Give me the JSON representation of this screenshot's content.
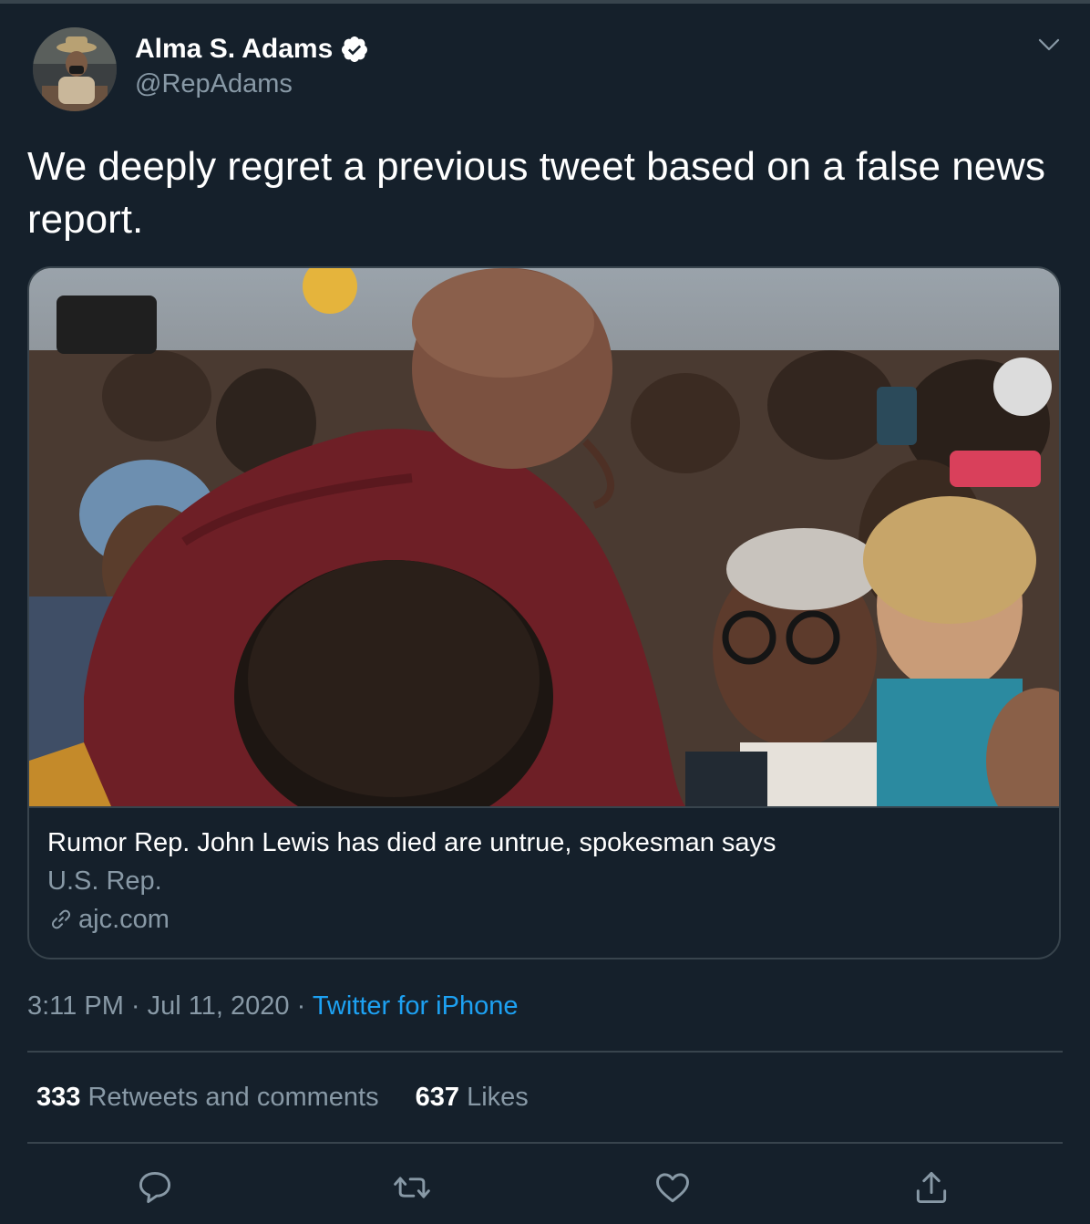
{
  "author": {
    "display_name": "Alma S. Adams",
    "handle": "@RepAdams",
    "verified": true
  },
  "tweet": {
    "text": "We deeply regret a previous tweet based on a false news report."
  },
  "card": {
    "title": "Rumor Rep. John Lewis has died are untrue, spokesman says",
    "description": "U.S. Rep.",
    "domain": "ajc.com"
  },
  "meta": {
    "time": "3:11 PM",
    "separator": "·",
    "date": "Jul 11, 2020",
    "source": "Twitter for iPhone"
  },
  "stats": {
    "retweets_count": "333",
    "retweets_label": "Retweets and comments",
    "likes_count": "637",
    "likes_label": "Likes"
  },
  "icons": {
    "verified": "verified-badge-icon",
    "more": "chevron-down-icon",
    "link": "link-icon",
    "reply": "reply-icon",
    "retweet": "retweet-icon",
    "like": "heart-icon",
    "share": "share-icon"
  },
  "colors": {
    "background": "#15202b",
    "border": "#38444d",
    "secondary_text": "#8899a6",
    "accent": "#1da1f2"
  }
}
